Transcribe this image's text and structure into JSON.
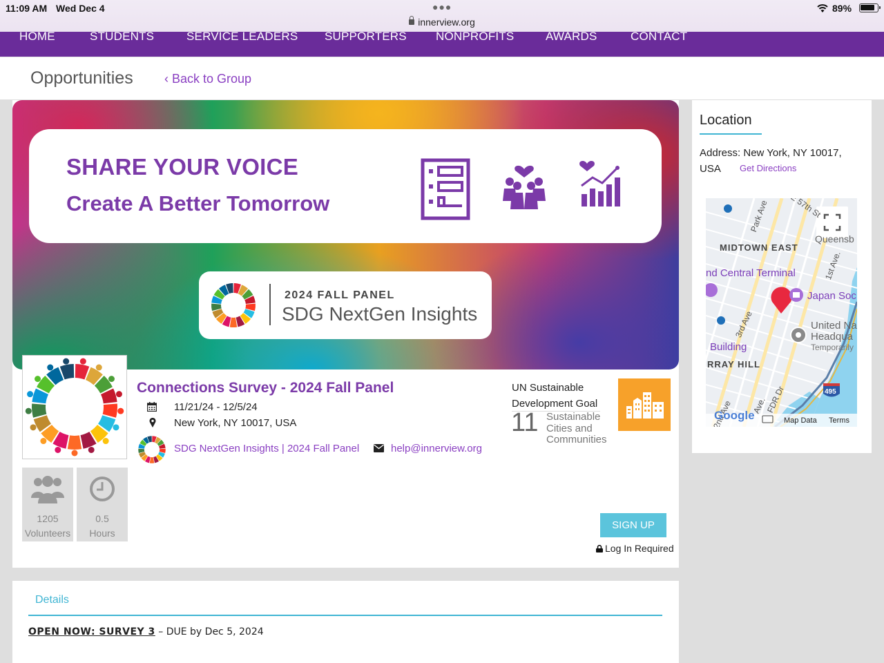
{
  "status_bar": {
    "time": "11:09 AM",
    "date": "Wed Dec 4",
    "url": "innerview.org",
    "battery": "89%"
  },
  "nav": {
    "items": [
      "HOME",
      "STUDENTS",
      "SERVICE LEADERS",
      "SUPPORTERS",
      "NONPROFITS",
      "AWARDS",
      "CONTACT"
    ]
  },
  "subheader": {
    "title": "Opportunities",
    "back_link": "‹ Back to Group"
  },
  "banner": {
    "headline": "SHARE YOUR VOICE",
    "subheadline": "Create A Better Tomorrow",
    "panel_line1": "2024 FALL PANEL",
    "panel_line2": "SDG NextGen Insights"
  },
  "opportunity": {
    "title": "Connections Survey - 2024 Fall Panel",
    "dates": "11/21/24 - 12/5/24",
    "location": "New York, NY 10017, USA",
    "group": "SDG NextGen Insights | 2024 Fall Panel",
    "email": "help@innerview.org",
    "stats": {
      "volunteers_count": "1205",
      "volunteers_label": "Volunteers",
      "hours_count": "0.5",
      "hours_label": "Hours"
    },
    "sdg": {
      "label_line1": "UN Sustainable",
      "label_line2": "Development Goal",
      "number": "11",
      "name_line1": "Sustainable",
      "name_line2": "Cities and",
      "name_line3": "Communities",
      "color": "#f7a12a"
    },
    "signup_label": "SIGN UP",
    "login_required": "Log In Required"
  },
  "details": {
    "tab_label": "Details",
    "headline": "OPEN NOW: SURVEY 3",
    "text": " – DUE by Dec 5, 2024"
  },
  "location": {
    "title": "Location",
    "address": "Address: New York, NY 10017, USA",
    "directions": "Get Directions",
    "map": {
      "labels": {
        "park_ave": "Park Ave",
        "e57": "E 57th St",
        "queens": "Queensb",
        "midtown": "MIDTOWN EAST",
        "terminal": "nd Central Terminal",
        "first_ave": "1st Ave.",
        "japan": "Japan Soc",
        "un1": "United Na",
        "un2": "Headqua",
        "un3": "Temporarily",
        "third_ave": "3rd Ave",
        "building": "Building",
        "murray": "RRAY HILL",
        "fdr": "FDR Dr",
        "second_ave": "2nd Ave",
        "ave": "Ave.",
        "shield": "495",
        "google": "Google",
        "map_data": "Map Data",
        "terms": "Terms"
      }
    }
  },
  "colors": {
    "nav_bg": "#6a2c9a",
    "accent_purple": "#7b3aa8",
    "link_purple": "#8a3fc2",
    "accent_teal": "#3fb5d3",
    "signup_bg": "#5bc4dc",
    "map_pin": "#e8283f"
  }
}
